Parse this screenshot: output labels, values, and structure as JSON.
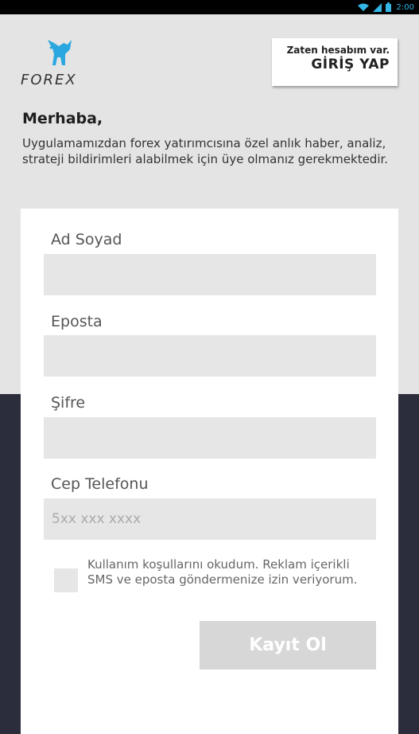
{
  "status_bar": {
    "time": "2:00",
    "icons": [
      "wifi-icon",
      "signal-icon",
      "battery-icon"
    ]
  },
  "brand": {
    "logo_text": "FOREX",
    "logo_color": "#2aa7df"
  },
  "login": {
    "hint": "Zaten hesabım var.",
    "cta": "GİRİŞ YAP"
  },
  "intro": {
    "greeting": "Merhaba,",
    "message": "Uygulamamızdan forex yatırımcısına özel anlık haber, analiz, strateji bildirimleri alabilmek için üye olmanız gerekmektedir."
  },
  "form": {
    "name_label": "Ad Soyad",
    "name_value": "",
    "email_label": "Eposta",
    "email_value": "",
    "password_label": "Şifre",
    "password_value": "",
    "phone_label": "Cep Telefonu",
    "phone_placeholder": "5xx xxx xxxx",
    "terms_checked": false,
    "terms_text": "Kullanım koşullarını okudum. Reklam içerikli SMS ve eposta göndermenize izin veriyorum.",
    "submit_label": "Kayıt Ol"
  },
  "colors": {
    "top_bg": "#e4e4e4",
    "bottom_bg": "#2b2d3c",
    "input_bg": "#e6e6e6",
    "button_bg": "#d7d7d7"
  }
}
